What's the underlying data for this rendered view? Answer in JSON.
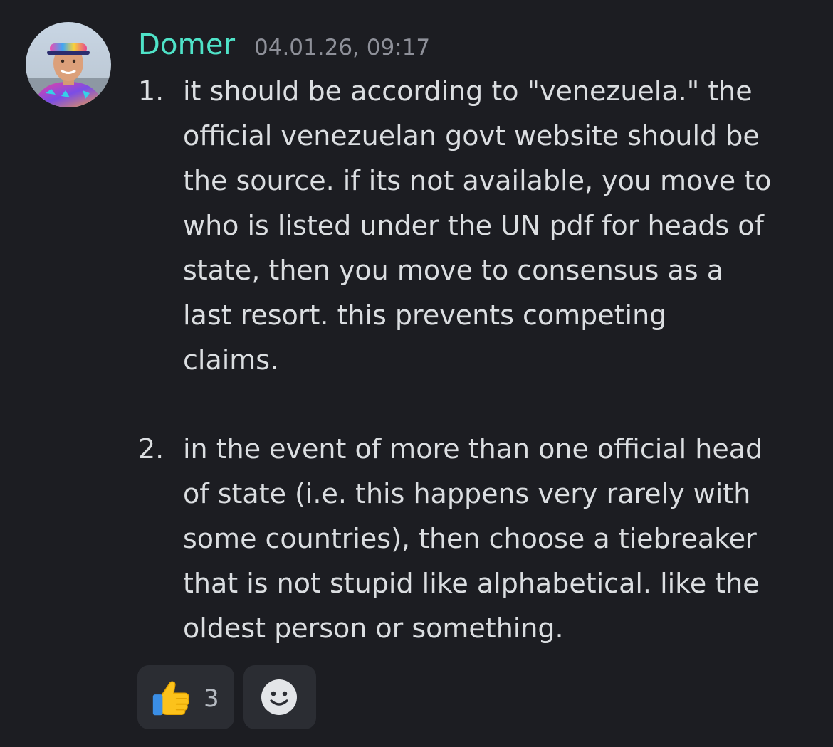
{
  "message": {
    "username": "Domer",
    "timestamp": "04.01.26, 09:17",
    "username_color": "#4fe3c8",
    "list": [
      {
        "number": "1.",
        "text": "it should be according to \"venezuela.\" the\nofficial venezuelan govt website should be\nthe source. if its not available, you move to\nwho is listed under the UN pdf for heads of\nstate, then you move to consensus as a\nlast resort. this prevents competing\nclaims."
      },
      {
        "number": "2.",
        "text": "in the event of more than one official head\nof state (i.e. this happens very rarely with\nsome countries), then choose a tiebreaker\nthat is not stupid like alphabetical. like the\noldest person or something."
      }
    ],
    "reactions": [
      {
        "emoji": "thumbs-up-icon",
        "count": "3"
      }
    ],
    "add_reaction_icon": "smiley-icon"
  }
}
